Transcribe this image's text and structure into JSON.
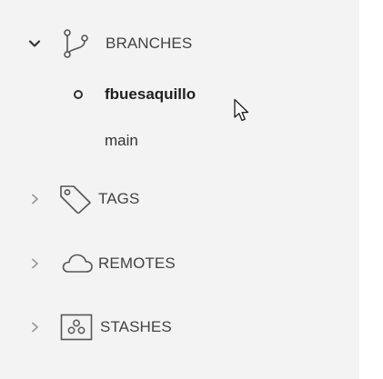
{
  "sidebar": {
    "sections": [
      {
        "key": "branches",
        "label": "BRANCHES",
        "expanded": true,
        "icon": "git-branch-icon"
      },
      {
        "key": "tags",
        "label": "TAGS",
        "expanded": false,
        "icon": "tag-icon"
      },
      {
        "key": "remotes",
        "label": "REMOTES",
        "expanded": false,
        "icon": "cloud-icon"
      },
      {
        "key": "stashes",
        "label": "STASHES",
        "expanded": false,
        "icon": "stash-icon"
      }
    ],
    "branches": [
      {
        "label": "fbuesaquillo",
        "current": true
      },
      {
        "label": "main",
        "current": false
      }
    ]
  },
  "colors": {
    "panel_background": "#f3f3f3",
    "text": "#424242",
    "icon": "#444444"
  }
}
